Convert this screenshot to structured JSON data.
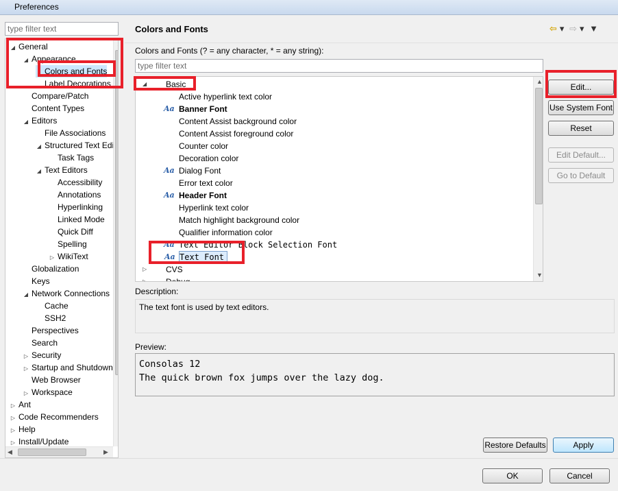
{
  "window": {
    "title": "Preferences"
  },
  "left": {
    "filter_placeholder": "type filter text",
    "tree": [
      {
        "label": "General",
        "indent": 0,
        "arrow": "expanded"
      },
      {
        "label": "Appearance",
        "indent": 1,
        "arrow": "expanded"
      },
      {
        "label": "Colors and Fonts",
        "indent": 2,
        "arrow": "none",
        "selected": true
      },
      {
        "label": "Label Decorations",
        "indent": 2,
        "arrow": "none"
      },
      {
        "label": "Compare/Patch",
        "indent": 1,
        "arrow": "none"
      },
      {
        "label": "Content Types",
        "indent": 1,
        "arrow": "none"
      },
      {
        "label": "Editors",
        "indent": 1,
        "arrow": "expanded"
      },
      {
        "label": "File Associations",
        "indent": 2,
        "arrow": "none"
      },
      {
        "label": "Structured Text Editors",
        "indent": 2,
        "arrow": "expanded"
      },
      {
        "label": "Task Tags",
        "indent": 3,
        "arrow": "none"
      },
      {
        "label": "Text Editors",
        "indent": 2,
        "arrow": "expanded"
      },
      {
        "label": "Accessibility",
        "indent": 3,
        "arrow": "none"
      },
      {
        "label": "Annotations",
        "indent": 3,
        "arrow": "none"
      },
      {
        "label": "Hyperlinking",
        "indent": 3,
        "arrow": "none"
      },
      {
        "label": "Linked Mode",
        "indent": 3,
        "arrow": "none"
      },
      {
        "label": "Quick Diff",
        "indent": 3,
        "arrow": "none"
      },
      {
        "label": "Spelling",
        "indent": 3,
        "arrow": "none"
      },
      {
        "label": "WikiText",
        "indent": 3,
        "arrow": "collapsed"
      },
      {
        "label": "Globalization",
        "indent": 1,
        "arrow": "none"
      },
      {
        "label": "Keys",
        "indent": 1,
        "arrow": "none"
      },
      {
        "label": "Network Connections",
        "indent": 1,
        "arrow": "expanded"
      },
      {
        "label": "Cache",
        "indent": 2,
        "arrow": "none"
      },
      {
        "label": "SSH2",
        "indent": 2,
        "arrow": "none"
      },
      {
        "label": "Perspectives",
        "indent": 1,
        "arrow": "none"
      },
      {
        "label": "Search",
        "indent": 1,
        "arrow": "none"
      },
      {
        "label": "Security",
        "indent": 1,
        "arrow": "collapsed"
      },
      {
        "label": "Startup and Shutdown",
        "indent": 1,
        "arrow": "collapsed"
      },
      {
        "label": "Web Browser",
        "indent": 1,
        "arrow": "none"
      },
      {
        "label": "Workspace",
        "indent": 1,
        "arrow": "collapsed"
      },
      {
        "label": "Ant",
        "indent": 0,
        "arrow": "collapsed"
      },
      {
        "label": "Code Recommenders",
        "indent": 0,
        "arrow": "collapsed"
      },
      {
        "label": "Help",
        "indent": 0,
        "arrow": "collapsed"
      },
      {
        "label": "Install/Update",
        "indent": 0,
        "arrow": "collapsed"
      }
    ]
  },
  "main": {
    "title": "Colors and Fonts",
    "instructions": "Colors and Fonts (? = any character, * = any string):",
    "filter_placeholder": "type filter text",
    "list": [
      {
        "label": "Basic",
        "indent": 0,
        "arrow": "expanded"
      },
      {
        "label": "Active hyperlink text color",
        "indent": 1
      },
      {
        "label": "Banner Font",
        "indent": 1,
        "font_icon": true,
        "style": "bold"
      },
      {
        "label": "Content Assist background color",
        "indent": 1
      },
      {
        "label": "Content Assist foreground color",
        "indent": 1
      },
      {
        "label": "Counter color",
        "indent": 1
      },
      {
        "label": "Decoration color",
        "indent": 1
      },
      {
        "label": "Dialog Font",
        "indent": 1,
        "font_icon": true
      },
      {
        "label": "Error text color",
        "indent": 1
      },
      {
        "label": "Header Font",
        "indent": 1,
        "font_icon": true,
        "style": "bold"
      },
      {
        "label": "Hyperlink text color",
        "indent": 1
      },
      {
        "label": "Match highlight background color",
        "indent": 1
      },
      {
        "label": "Qualifier information color",
        "indent": 1
      },
      {
        "label": "Text Editor Block Selection Font",
        "indent": 1,
        "font_icon": true,
        "style": "mono"
      },
      {
        "label": "Text Font",
        "indent": 1,
        "font_icon": true,
        "style": "mono",
        "selected": true
      },
      {
        "label": "CVS",
        "indent": 0,
        "arrow": "collapsed"
      },
      {
        "label": "Debug",
        "indent": 0,
        "arrow": "collapsed"
      }
    ],
    "buttons": {
      "edit": "Edit...",
      "use_system_font": "Use System Font",
      "reset": "Reset",
      "edit_default": "Edit Default...",
      "go_to_default": "Go to Default"
    },
    "description_label": "Description:",
    "description_text": "The text font is used by text editors.",
    "preview_label": "Preview:",
    "preview_lines": [
      "Consolas 12",
      "The quick brown fox jumps over the lazy dog."
    ],
    "restore_defaults": "Restore Defaults",
    "apply": "Apply"
  },
  "footer": {
    "ok": "OK",
    "cancel": "Cancel"
  },
  "colors": {
    "highlight": "#e8202a",
    "selection": "#cce8ff"
  }
}
